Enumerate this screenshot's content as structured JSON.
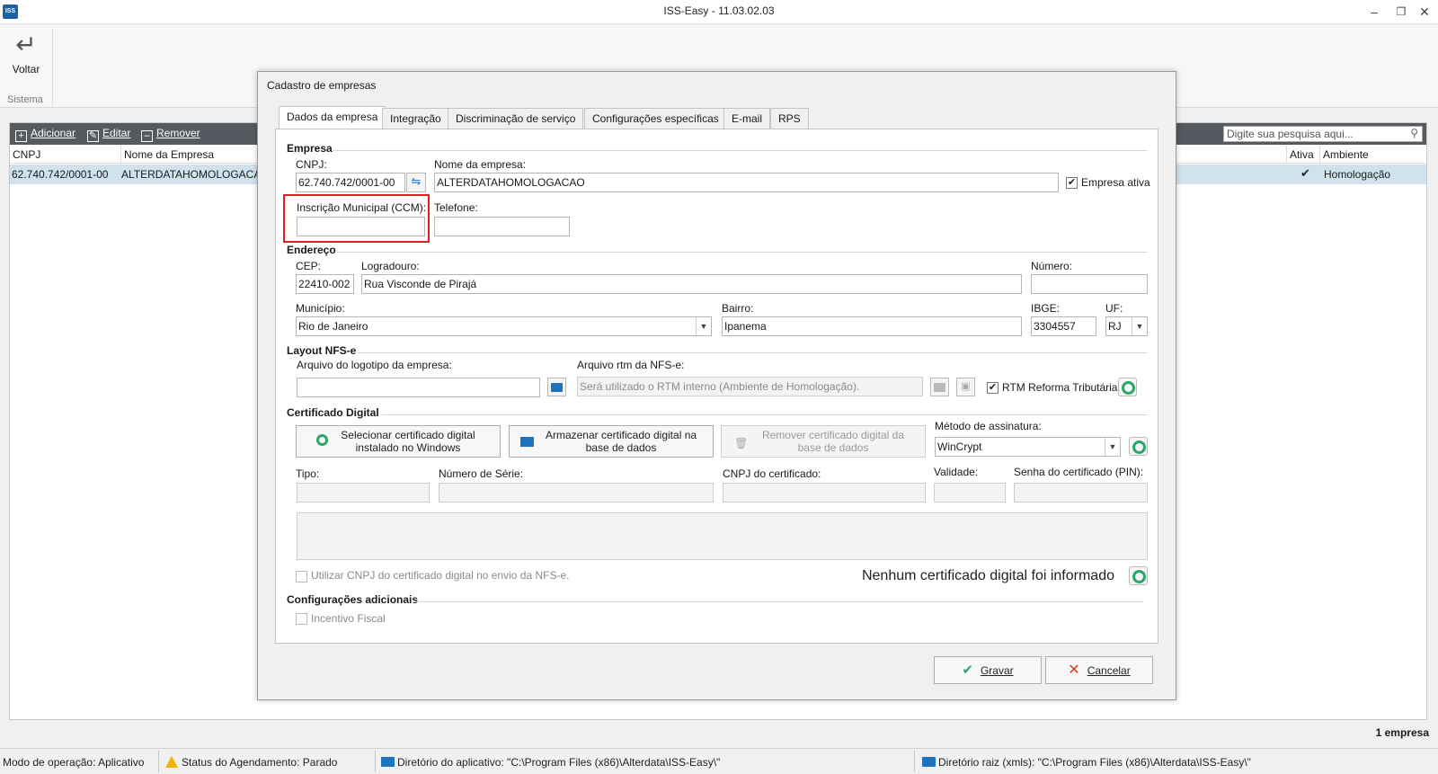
{
  "window": {
    "title": "ISS-Easy - 11.03.02.03",
    "app_icon": "ISS"
  },
  "ribbon": {
    "voltar_label": "Voltar",
    "group_label": "Sistema"
  },
  "grid": {
    "toolbar": {
      "add": "Adicionar",
      "edit": "Editar",
      "remove": "Remover",
      "search_placeholder": "Digite sua pesquisa aqui..."
    },
    "columns": {
      "cnpj": "CNPJ",
      "nome": "Nome da Empresa",
      "ativa": "Ativa",
      "ambiente": "Ambiente"
    },
    "rows": [
      {
        "cnpj": "62.740.742/0001-00",
        "nome": "ALTERDATAHOMOLOGACAO",
        "ativa": true,
        "ambiente": "Homologação"
      }
    ],
    "count": "1 empresa"
  },
  "dialog": {
    "title": "Cadastro de empresas",
    "tabs": [
      "Dados da empresa",
      "Integração",
      "Discriminação de serviço",
      "Configurações específicas",
      "E-mail",
      "RPS"
    ],
    "empresa": {
      "section": "Empresa",
      "cnpj_label": "CNPJ:",
      "cnpj_value": "62.740.742/0001-00",
      "nome_label": "Nome da empresa:",
      "nome_value": "ALTERDATAHOMOLOGACAO",
      "ativa_label": "Empresa ativa",
      "ccm_label": "Inscrição Municipal (CCM):",
      "ccm_value": "",
      "telefone_label": "Telefone:",
      "telefone_value": ""
    },
    "endereco": {
      "section": "Endereço",
      "cep_label": "CEP:",
      "cep_value": "22410-002",
      "logradouro_label": "Logradouro:",
      "logradouro_value": "Rua Visconde de Pirajá",
      "numero_label": "Número:",
      "numero_value": "",
      "municipio_label": "Município:",
      "municipio_value": "Rio de Janeiro",
      "bairro_label": "Bairro:",
      "bairro_value": "Ipanema",
      "ibge_label": "IBGE:",
      "ibge_value": "3304557",
      "uf_label": "UF:",
      "uf_value": "RJ"
    },
    "layout": {
      "section": "Layout NFS-e",
      "logo_label": "Arquivo do logotipo da empresa:",
      "logo_value": "",
      "rtm_label": "Arquivo rtm da NFS-e:",
      "rtm_placeholder": "Será utilizado o RTM interno (Ambiente de Homologação).",
      "reforma_label": "RTM Reforma Tributária"
    },
    "certificado": {
      "section": "Certificado Digital",
      "btn_select_1": "Selecionar certificado digital",
      "btn_select_2": "instalado no Windows",
      "btn_store_1": "Armazenar certificado digital na",
      "btn_store_2": "base de dados",
      "btn_remove_1": "Remover certificado digital da",
      "btn_remove_2": "base de dados",
      "metodo_label": "Método de assinatura:",
      "metodo_value": "WinCrypt",
      "tipo_label": "Tipo:",
      "serie_label": "Número de Série:",
      "cnpj_cert_label": "CNPJ do certificado:",
      "validade_label": "Validade:",
      "senha_label": "Senha do certificado (PIN):",
      "usar_cnpj_label": "Utilizar CNPJ do certificado digital no envio da NFS-e.",
      "status_text": "Nenhum certificado digital foi informado"
    },
    "adicionais": {
      "section": "Configurações adicionais",
      "incentivo_label": "Incentivo Fiscal"
    },
    "buttons": {
      "gravar": "Gravar",
      "cancelar": "Cancelar"
    }
  },
  "statusbar": {
    "modo": "Modo de operação: Aplicativo",
    "agendamento": "Status do Agendamento: Parado",
    "dir_app": "Diretório do aplicativo: \"C:\\Program Files (x86)\\Alterdata\\ISS-Easy\\\"",
    "dir_raiz": "Diretório raiz (xmls): \"C:\\Program Files (x86)\\Alterdata\\ISS-Easy\\\""
  },
  "colors": {
    "accent": "#1e73be",
    "selected_row": "#cfe2ee",
    "highlight_box": "#e02020",
    "ring": "#2ca66a"
  }
}
